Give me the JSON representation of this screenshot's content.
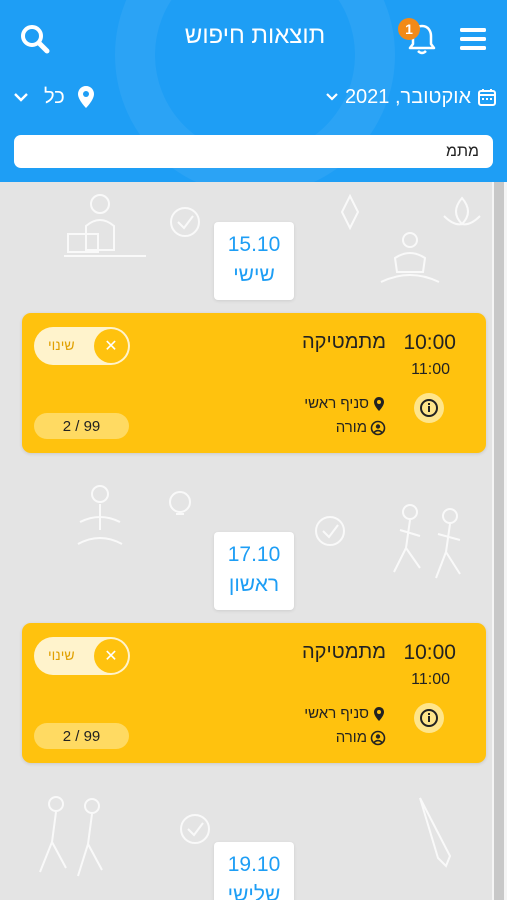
{
  "header": {
    "title": "תוצאות חיפוש",
    "notification_count": "1",
    "date_filter": "אוקטובר, 2021",
    "location_filter": "כל"
  },
  "search": {
    "value": "מתמ"
  },
  "days": [
    {
      "date": "15.10",
      "day": "שישי",
      "session": {
        "start": "10:00",
        "end": "11:00",
        "subject": "מתמטיקה",
        "branch": "סניף ראשי",
        "instructor": "מורה",
        "toggle_label": "שינוי",
        "capacity": "2 / 99"
      }
    },
    {
      "date": "17.10",
      "day": "ראשון",
      "session": {
        "start": "10:00",
        "end": "11:00",
        "subject": "מתמטיקה",
        "branch": "סניף ראשי",
        "instructor": "מורה",
        "toggle_label": "שינוי",
        "capacity": "2 / 99"
      }
    },
    {
      "date": "19.10",
      "day": "שלישי"
    }
  ],
  "colors": {
    "primary": "#1e9ef5",
    "card": "#ffc20e",
    "badge": "#f28a18"
  }
}
